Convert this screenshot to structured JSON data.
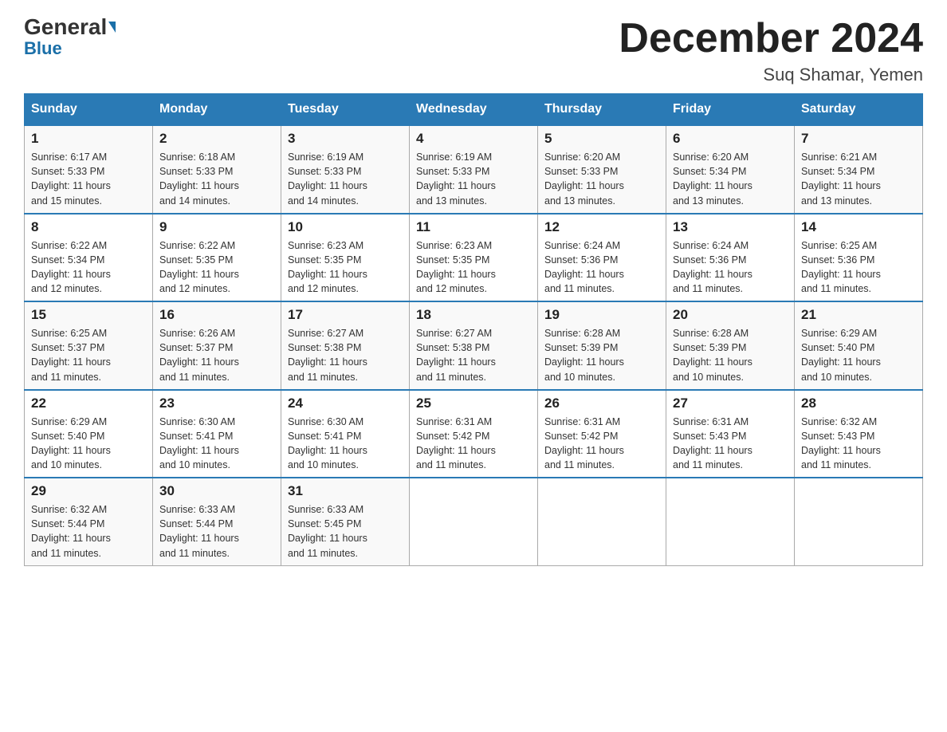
{
  "header": {
    "logo_general": "General",
    "logo_blue": "Blue",
    "title": "December 2024",
    "subtitle": "Suq Shamar, Yemen"
  },
  "days_of_week": [
    "Sunday",
    "Monday",
    "Tuesday",
    "Wednesday",
    "Thursday",
    "Friday",
    "Saturday"
  ],
  "weeks": [
    [
      {
        "day": "1",
        "sunrise": "6:17 AM",
        "sunset": "5:33 PM",
        "daylight": "11 hours and 15 minutes."
      },
      {
        "day": "2",
        "sunrise": "6:18 AM",
        "sunset": "5:33 PM",
        "daylight": "11 hours and 14 minutes."
      },
      {
        "day": "3",
        "sunrise": "6:19 AM",
        "sunset": "5:33 PM",
        "daylight": "11 hours and 14 minutes."
      },
      {
        "day": "4",
        "sunrise": "6:19 AM",
        "sunset": "5:33 PM",
        "daylight": "11 hours and 13 minutes."
      },
      {
        "day": "5",
        "sunrise": "6:20 AM",
        "sunset": "5:33 PM",
        "daylight": "11 hours and 13 minutes."
      },
      {
        "day": "6",
        "sunrise": "6:20 AM",
        "sunset": "5:34 PM",
        "daylight": "11 hours and 13 minutes."
      },
      {
        "day": "7",
        "sunrise": "6:21 AM",
        "sunset": "5:34 PM",
        "daylight": "11 hours and 13 minutes."
      }
    ],
    [
      {
        "day": "8",
        "sunrise": "6:22 AM",
        "sunset": "5:34 PM",
        "daylight": "11 hours and 12 minutes."
      },
      {
        "day": "9",
        "sunrise": "6:22 AM",
        "sunset": "5:35 PM",
        "daylight": "11 hours and 12 minutes."
      },
      {
        "day": "10",
        "sunrise": "6:23 AM",
        "sunset": "5:35 PM",
        "daylight": "11 hours and 12 minutes."
      },
      {
        "day": "11",
        "sunrise": "6:23 AM",
        "sunset": "5:35 PM",
        "daylight": "11 hours and 12 minutes."
      },
      {
        "day": "12",
        "sunrise": "6:24 AM",
        "sunset": "5:36 PM",
        "daylight": "11 hours and 11 minutes."
      },
      {
        "day": "13",
        "sunrise": "6:24 AM",
        "sunset": "5:36 PM",
        "daylight": "11 hours and 11 minutes."
      },
      {
        "day": "14",
        "sunrise": "6:25 AM",
        "sunset": "5:36 PM",
        "daylight": "11 hours and 11 minutes."
      }
    ],
    [
      {
        "day": "15",
        "sunrise": "6:25 AM",
        "sunset": "5:37 PM",
        "daylight": "11 hours and 11 minutes."
      },
      {
        "day": "16",
        "sunrise": "6:26 AM",
        "sunset": "5:37 PM",
        "daylight": "11 hours and 11 minutes."
      },
      {
        "day": "17",
        "sunrise": "6:27 AM",
        "sunset": "5:38 PM",
        "daylight": "11 hours and 11 minutes."
      },
      {
        "day": "18",
        "sunrise": "6:27 AM",
        "sunset": "5:38 PM",
        "daylight": "11 hours and 11 minutes."
      },
      {
        "day": "19",
        "sunrise": "6:28 AM",
        "sunset": "5:39 PM",
        "daylight": "11 hours and 10 minutes."
      },
      {
        "day": "20",
        "sunrise": "6:28 AM",
        "sunset": "5:39 PM",
        "daylight": "11 hours and 10 minutes."
      },
      {
        "day": "21",
        "sunrise": "6:29 AM",
        "sunset": "5:40 PM",
        "daylight": "11 hours and 10 minutes."
      }
    ],
    [
      {
        "day": "22",
        "sunrise": "6:29 AM",
        "sunset": "5:40 PM",
        "daylight": "11 hours and 10 minutes."
      },
      {
        "day": "23",
        "sunrise": "6:30 AM",
        "sunset": "5:41 PM",
        "daylight": "11 hours and 10 minutes."
      },
      {
        "day": "24",
        "sunrise": "6:30 AM",
        "sunset": "5:41 PM",
        "daylight": "11 hours and 10 minutes."
      },
      {
        "day": "25",
        "sunrise": "6:31 AM",
        "sunset": "5:42 PM",
        "daylight": "11 hours and 11 minutes."
      },
      {
        "day": "26",
        "sunrise": "6:31 AM",
        "sunset": "5:42 PM",
        "daylight": "11 hours and 11 minutes."
      },
      {
        "day": "27",
        "sunrise": "6:31 AM",
        "sunset": "5:43 PM",
        "daylight": "11 hours and 11 minutes."
      },
      {
        "day": "28",
        "sunrise": "6:32 AM",
        "sunset": "5:43 PM",
        "daylight": "11 hours and 11 minutes."
      }
    ],
    [
      {
        "day": "29",
        "sunrise": "6:32 AM",
        "sunset": "5:44 PM",
        "daylight": "11 hours and 11 minutes."
      },
      {
        "day": "30",
        "sunrise": "6:33 AM",
        "sunset": "5:44 PM",
        "daylight": "11 hours and 11 minutes."
      },
      {
        "day": "31",
        "sunrise": "6:33 AM",
        "sunset": "5:45 PM",
        "daylight": "11 hours and 11 minutes."
      },
      null,
      null,
      null,
      null
    ]
  ],
  "labels": {
    "sunrise": "Sunrise:",
    "sunset": "Sunset:",
    "daylight": "Daylight:"
  }
}
